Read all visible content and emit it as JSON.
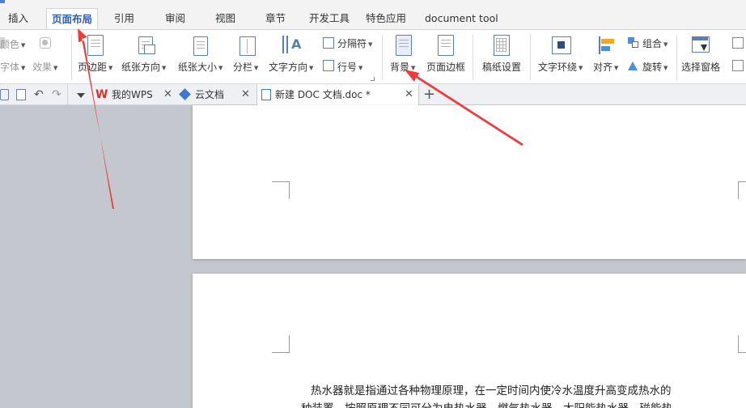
{
  "menu": {
    "tabs": [
      "插入",
      "页面布局",
      "引用",
      "审阅",
      "视图",
      "章节",
      "开发工具",
      "特色应用",
      "document tool"
    ],
    "active_index": 1
  },
  "ribbon": {
    "color_label": "颜色",
    "font_label": "字体",
    "effect_label": "效果",
    "margins_label": "页边距",
    "orientation_label": "纸张方向",
    "size_label": "纸张大小",
    "columns_label": "分栏",
    "text_direction_label": "文字方向",
    "breaks_label": "分隔符",
    "line_numbers_label": "行号",
    "background_label": "背景",
    "page_border_label": "页面边框",
    "manuscript_label": "稿纸设置",
    "text_wrap_label": "文字环绕",
    "align_label": "对齐",
    "group_label": "组合",
    "rotate_label": "旋转",
    "selection_pane_label": "选择窗格"
  },
  "tabstrip": {
    "tabs": [
      {
        "label": "我的WPS",
        "icon": "wps-logo-icon"
      },
      {
        "label": "云文档",
        "icon": "cloud-doc-icon"
      },
      {
        "label": "新建 DOC 文档.doc *",
        "icon": "doc-file-icon"
      }
    ],
    "active_index": 2,
    "new_tab": "+"
  },
  "document": {
    "paragraph_line1": "热水器就是指通过各种物理原理，在一定时间内使冷水温度升高变成热水的",
    "paragraph_line2": "种装置，按照原理不同可分为电热水器、燃气热水器、太阳能热水器、磁能热"
  },
  "colors": {
    "accent": "#2f5fb3",
    "annotation_arrow": "#ee3b3b",
    "workspace": "#c4c7cd"
  }
}
